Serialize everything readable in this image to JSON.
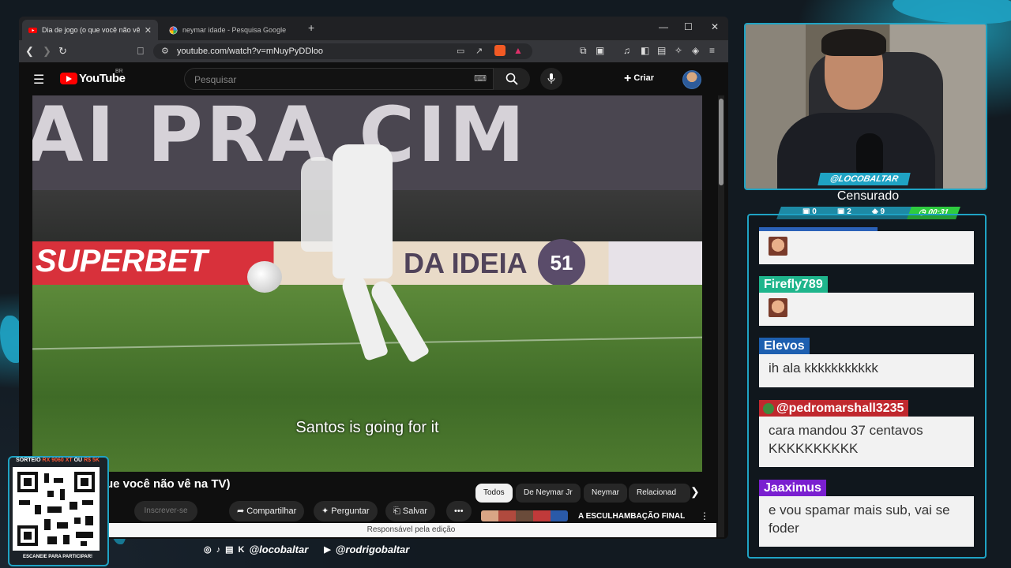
{
  "browser": {
    "tabs": [
      {
        "title": "Dia de jogo (o que você não vê na TV)",
        "close": "✕"
      },
      {
        "title": "neymar idade - Pesquisa Google"
      }
    ],
    "new_tab": "+",
    "window_controls": {
      "minimize": "—",
      "maximize": "☐",
      "close": "✕"
    },
    "url": "youtube.com/watch?v=mNuyPyDDloo"
  },
  "youtube": {
    "logo_text": "YouTube",
    "country": "BR",
    "search_placeholder": "Pesquisar",
    "create_label": "Criar",
    "video": {
      "subtitle": "Santos is going for it",
      "banner_text": "AI PRA CIM",
      "ad_red": "SUPERBET",
      "ad_mid": "DA IDEIA",
      "ad_number": "51"
    },
    "title_visible": "ue você não vê na TV)",
    "subscribe_label": "Inscrever-se",
    "actions": [
      {
        "label": "Compartilhar",
        "icon": "share-icon"
      },
      {
        "label": "Perguntar",
        "icon": "sparkle-icon"
      },
      {
        "label": "Salvar",
        "icon": "bookmark-icon"
      }
    ],
    "more_label": "•••",
    "chips": [
      {
        "label": "Todos",
        "active": true
      },
      {
        "label": "De Neymar Jr",
        "active": false
      },
      {
        "label": "Neymar",
        "active": false
      },
      {
        "label": "Relacionad",
        "active": false
      }
    ],
    "editor_bar": "Responsável pela edição",
    "related_title": "A ESCULHAMBAÇÃO FINAL"
  },
  "stream": {
    "handle": "@LOCOBALTAR",
    "status": "Censurado",
    "stats": {
      "a": "0",
      "b": "2",
      "c": "9"
    },
    "timer": "00:31"
  },
  "chat": [
    {
      "name": "",
      "text": "",
      "emoji": true,
      "tag_color": "#2b62b8"
    },
    {
      "name": "Firefly789",
      "text": "",
      "emoji": true,
      "tag_color": "#1fb58c"
    },
    {
      "name": "Elevos",
      "text": "ih ala kkkkkkkkkkk",
      "emoji": false,
      "tag_color": "#1d5fb0"
    },
    {
      "name": "@pedromarshall3235",
      "text": "cara mandou 37 centavos KKKKKKKKKK",
      "emoji": false,
      "tag_color": "#c0282e"
    },
    {
      "name": "Jaaximus",
      "text": "e vou spamar mais sub, vai se foder",
      "emoji": false,
      "tag_color": "#7a1fd0"
    }
  ],
  "socials": {
    "handle1": "@locobaltar",
    "handle2": "@rodrigobaltar"
  },
  "qr": {
    "top_text_a": "SORTEIO ",
    "top_text_b": "RX 9060 XT",
    "top_text_c": " OU ",
    "top_text_d": "R$ 5K",
    "bottom_text": "ESCANEIE PARA PARTICIPAR!"
  }
}
